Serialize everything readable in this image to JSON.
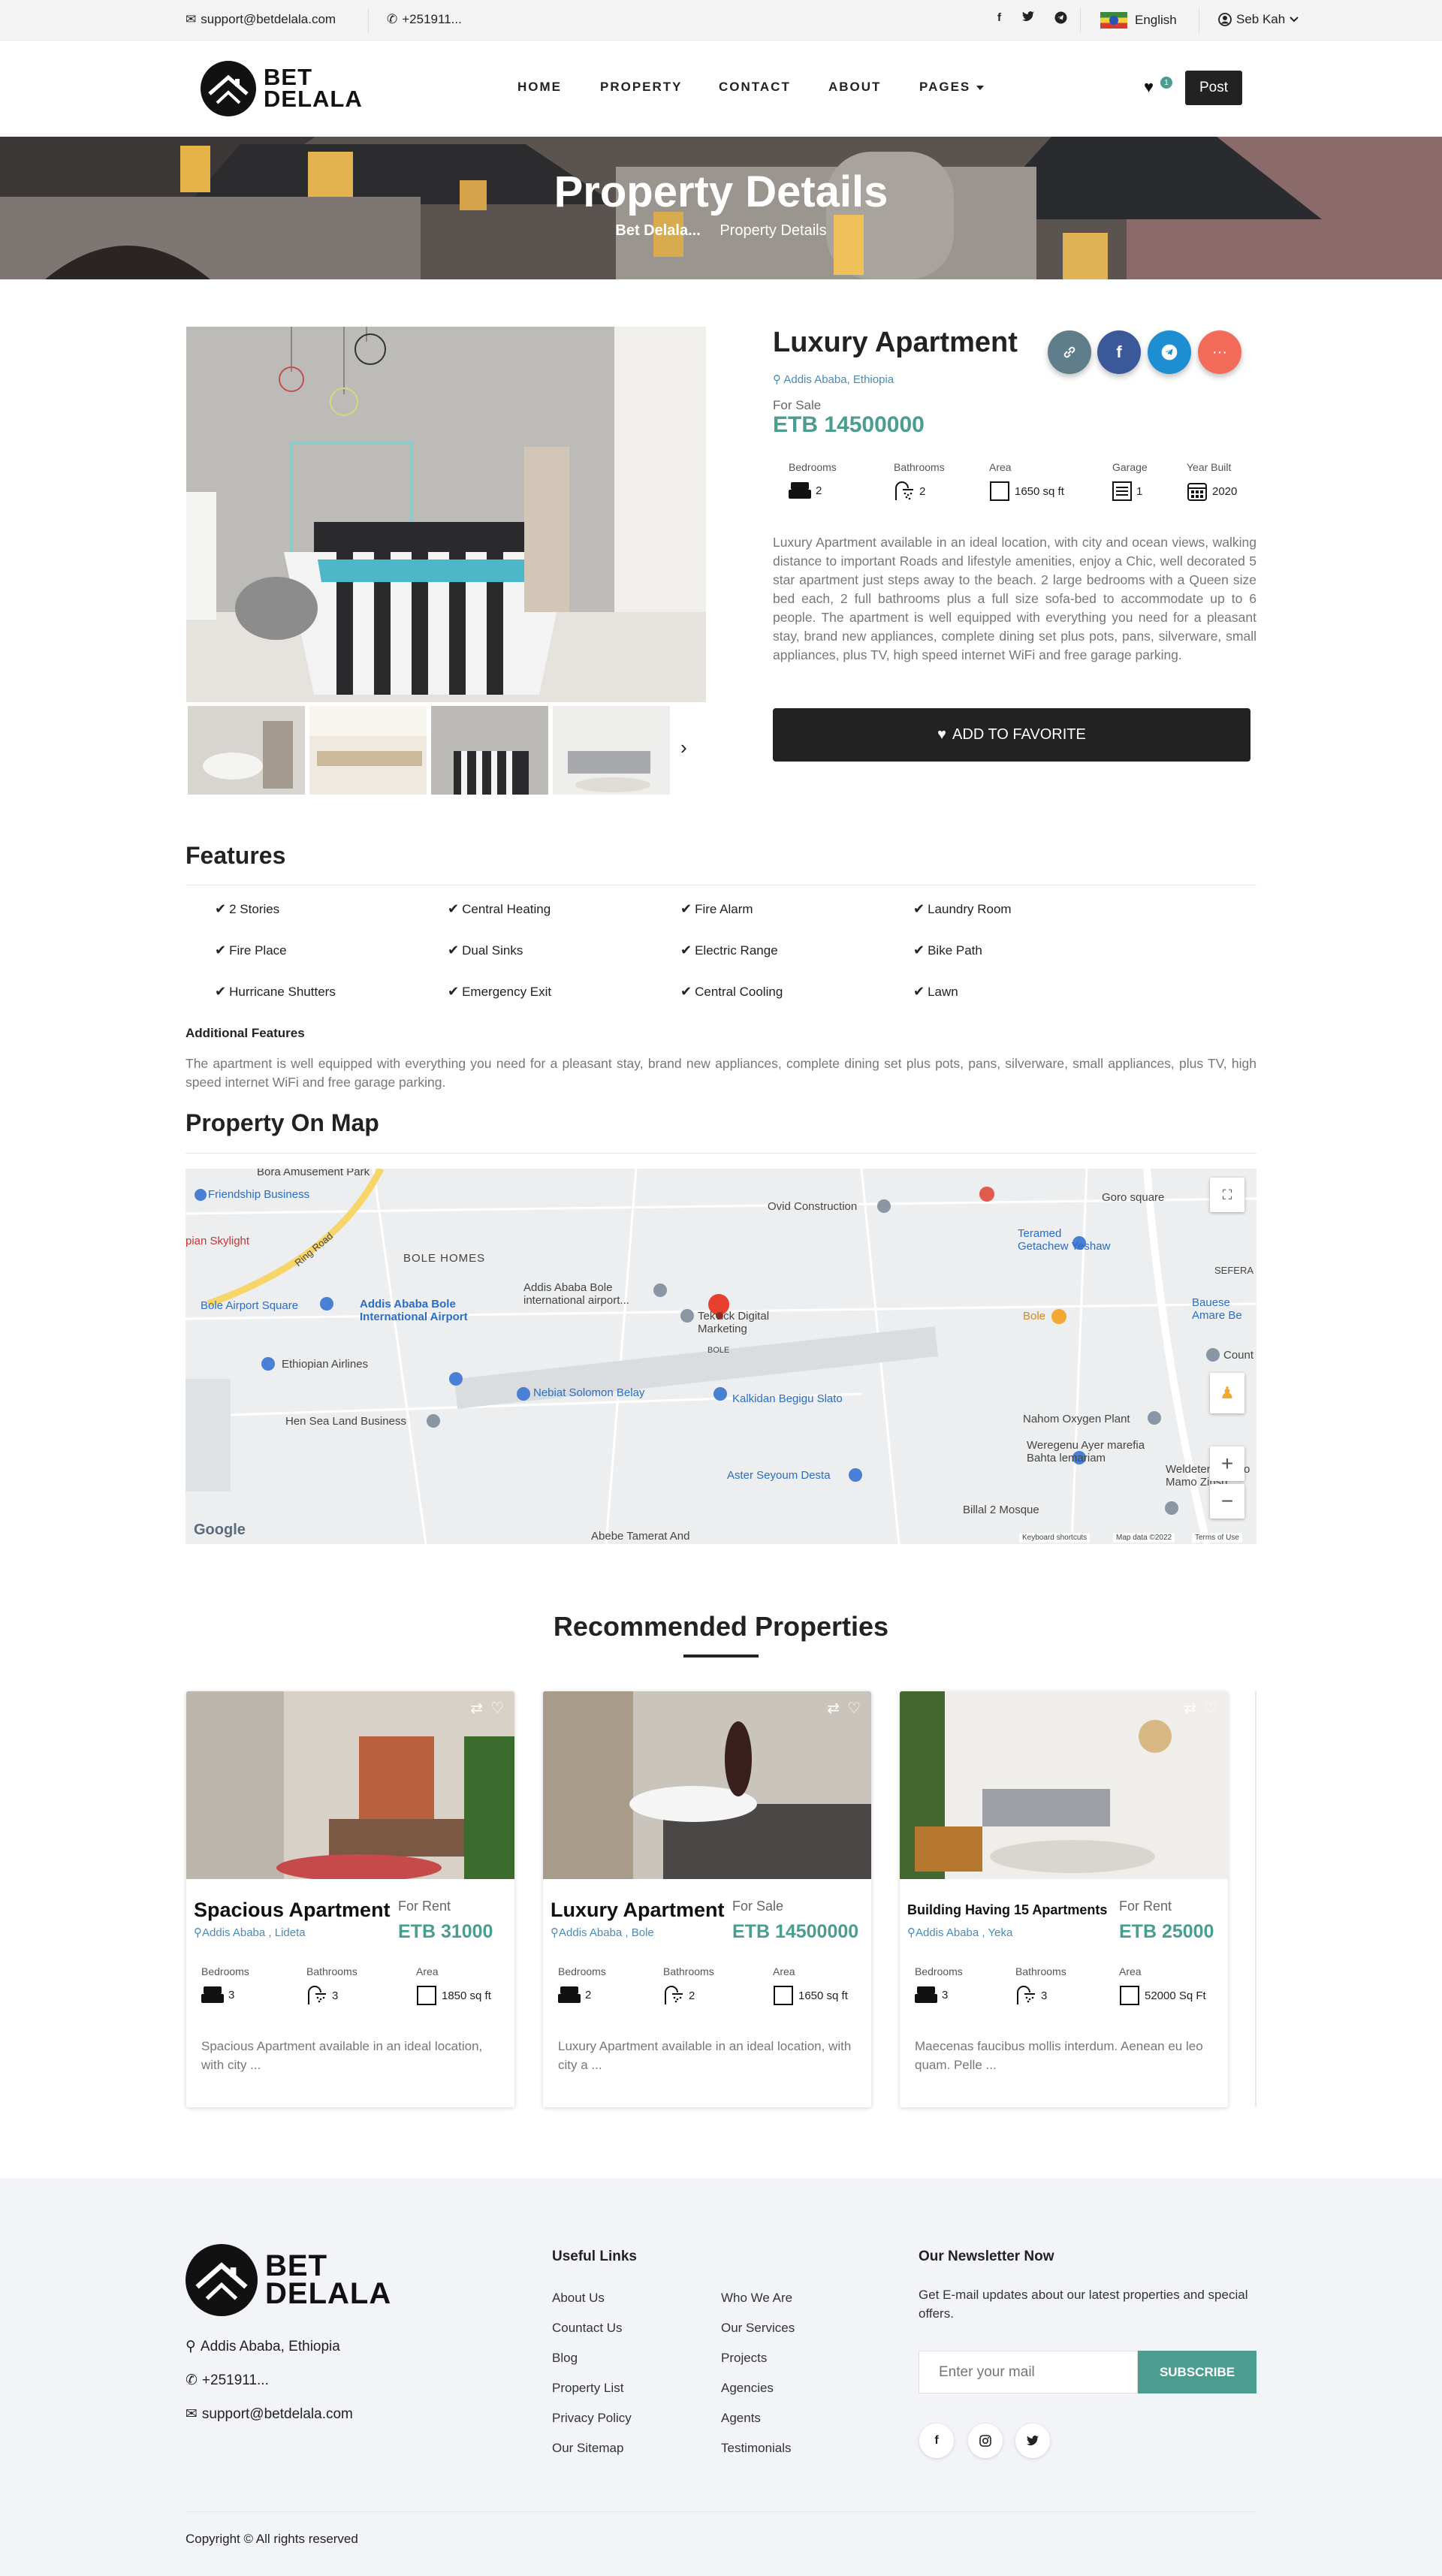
{
  "topbar": {
    "email": "support@betdelala.com",
    "phone": "+251911...",
    "language": "English",
    "user": "Seb Kah"
  },
  "brand": {
    "line1": "BET",
    "line2": "DELALA"
  },
  "nav": {
    "items": [
      "HOME",
      "PROPERTY",
      "CONTACT",
      "ABOUT",
      "PAGES"
    ],
    "favorites_count": "1",
    "post_label": "Post"
  },
  "hero": {
    "title": "Property Details",
    "crumb_home": "Bet Delala...",
    "crumb_current": "Property Details"
  },
  "property": {
    "title": "Luxury Apartment",
    "location": "Addis Ababa, Ethiopia",
    "status": "For Sale",
    "price": "ETB 14500000",
    "specs": [
      {
        "label": "Bedrooms",
        "value": "2",
        "icon": "bed-icon"
      },
      {
        "label": "Bathrooms",
        "value": "2",
        "icon": "shower-icon"
      },
      {
        "label": "Area",
        "value": "1650 sq ft",
        "icon": "area-icon"
      },
      {
        "label": "Garage",
        "value": "1",
        "icon": "garage-icon"
      },
      {
        "label": "Year Built",
        "value": "2020",
        "icon": "calendar-icon"
      }
    ],
    "description": "Luxury Apartment available in an ideal location, with city and ocean views, walking distance to important Roads and lifestyle amenities, enjoy a Chic, well decorated 5 star apartment just steps away to the beach. 2 large bedrooms with a Queen size bed each, 2 full bathrooms plus a full size sofa-bed to accommodate up to 6 people. The apartment is well equipped with everything you need for a pleasant stay, brand new appliances, complete dining set plus pots, pans, silverware, small appliances, plus TV, high speed internet WiFi and free garage parking.",
    "favorite_label": "ADD TO FAVORITE"
  },
  "features": {
    "title": "Features",
    "items": [
      "2 Stories",
      "Central Heating",
      "Fire Alarm",
      "Laundry Room",
      "Fire Place",
      "Dual Sinks",
      "Electric Range",
      "Bike Path",
      "Hurricane Shutters",
      "Emergency Exit",
      "Central Cooling",
      "Lawn"
    ],
    "additional_title": "Additional Features",
    "additional_text": "The apartment is well equipped with everything you need for a pleasant stay, brand new appliances, complete dining set plus pots, pans, silverware, small appliances, plus TV, high speed internet WiFi and free garage parking."
  },
  "map": {
    "title": "Property On Map",
    "labels": [
      "Bora Amusement Park",
      "Friendship Business",
      "pian Skylight",
      "Ring Road",
      "BOLE HOMES",
      "Bole Airport Square",
      "Addis Ababa Bole International Airport",
      "Ethiopian Airlines",
      "Hen Sea Land Business",
      "Nebiat Solomon Belay",
      "Kalkidan Begigu Slato",
      "Addis Ababa Bole international airport...",
      "Tekvick Digital Marketing",
      "BOLE",
      "Ovid Construction",
      "Goro square",
      "Teramed Getachew Yeshaw",
      "SEFERA",
      "Bole",
      "Bauese Amare Be",
      "Count",
      "Nahom Oxygen Plant",
      "Weregenu Ayer marefia Bahta lemariam",
      "Weldetensay Ato Mamo Zinsh...",
      "Aster Seyoum Desta",
      "Billal 2 Mosque",
      "Abebe Tamerat And"
    ],
    "attribution": [
      "Keyboard shortcuts",
      "Map data ©2022",
      "Terms of Use"
    ],
    "google": "Google"
  },
  "recommended": {
    "title": "Recommended Properties",
    "spec_labels": [
      "Bedrooms",
      "Bathrooms",
      "Area"
    ],
    "cards": [
      {
        "title": "Spacious Apartment",
        "location": "Addis Ababa , Lideta",
        "status": "For Rent",
        "price": "ETB 31000",
        "bedrooms": "3",
        "bathrooms": "3",
        "area": "1850 sq ft",
        "desc": "Spacious Apartment available in an ideal location, with city ..."
      },
      {
        "title": "Luxury Apartment",
        "location": "Addis Ababa , Bole",
        "status": "For Sale",
        "price": "ETB 14500000",
        "bedrooms": "2",
        "bathrooms": "2",
        "area": "1650 sq ft",
        "desc": "Luxury Apartment available in an ideal location, with city a ..."
      },
      {
        "title": "Building Having 15 Apartments",
        "location": "Addis Ababa , Yeka",
        "status": "For Rent",
        "price": "ETB 25000",
        "bedrooms": "3",
        "bathrooms": "3",
        "area": "52000 Sq Ft",
        "desc": "Maecenas faucibus mollis interdum. Aenean eu leo quam. Pelle ..."
      }
    ]
  },
  "footer": {
    "address": "Addis Ababa, Ethiopia",
    "phone": "+251911...",
    "email": "support@betdelala.com",
    "links_title": "Useful Links",
    "links_col1": [
      "About Us",
      "Countact Us",
      "Blog",
      "Property List",
      "Privacy Policy",
      "Our Sitemap"
    ],
    "links_col2": [
      "Who We Are",
      "Our Services",
      "Projects",
      "Agencies",
      "Agents",
      "Testimonials"
    ],
    "newsletter_title": "Our Newsletter Now",
    "newsletter_text": "Get E-mail updates about our latest properties and special offers.",
    "newsletter_placeholder": "Enter your mail",
    "subscribe_label": "SUBSCRIBE",
    "copyright": "Copyright © All rights reserved"
  },
  "colors": {
    "accent": "#4a9d8f",
    "dark": "#222222",
    "link": "#4a8bb5",
    "share_link": "#5f7d8a",
    "facebook": "#3b5998",
    "telegram": "#1d8ed1",
    "more": "#f26b5b"
  }
}
